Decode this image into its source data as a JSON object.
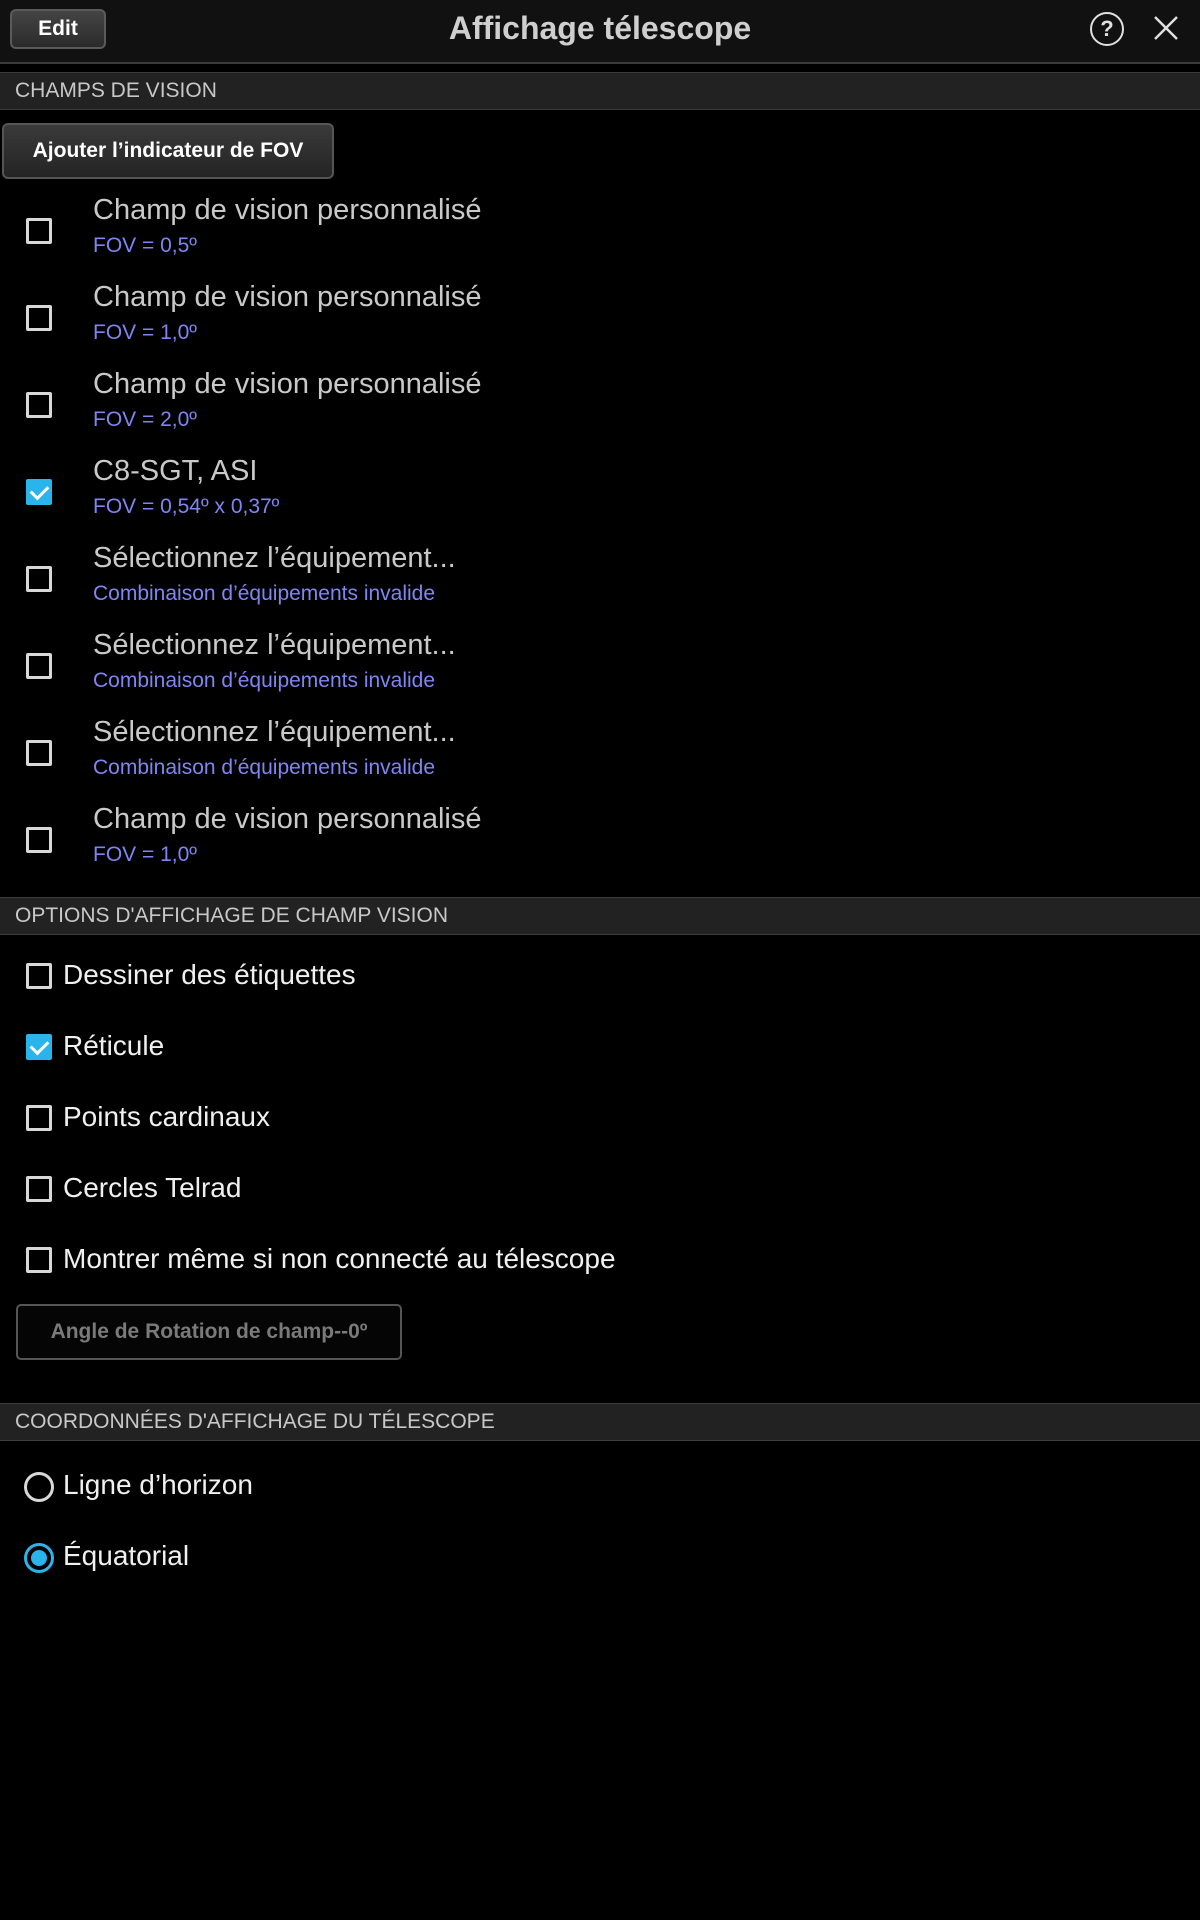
{
  "header": {
    "edit_label": "Edit",
    "title": "Affichage télescope",
    "help_glyph": "?"
  },
  "sections": {
    "fov": "CHAMPS DE VISION",
    "options": "OPTIONS D'AFFICHAGE DE CHAMP VISION",
    "coords": "COORDONNÉES D'AFFICHAGE DU TÉLESCOPE"
  },
  "add_fov_label": "Ajouter l’indicateur de FOV",
  "fov_items": [
    {
      "title": "Champ de vision personnalisé",
      "subtitle": "FOV = 0,5º",
      "checked": false
    },
    {
      "title": "Champ de vision personnalisé",
      "subtitle": "FOV = 1,0º",
      "checked": false
    },
    {
      "title": "Champ de vision personnalisé",
      "subtitle": "FOV = 2,0º",
      "checked": false
    },
    {
      "title": "C8-SGT, ASI",
      "subtitle": "FOV = 0,54º x 0,37º",
      "checked": true
    },
    {
      "title": "Sélectionnez l’équipement...",
      "subtitle": "Combinaison d’équipements invalide",
      "checked": false
    },
    {
      "title": "Sélectionnez l’équipement...",
      "subtitle": "Combinaison d’équipements invalide",
      "checked": false
    },
    {
      "title": "Sélectionnez l’équipement...",
      "subtitle": "Combinaison d’équipements invalide",
      "checked": false
    },
    {
      "title": "Champ de vision personnalisé",
      "subtitle": "FOV = 1,0º",
      "checked": false
    }
  ],
  "options": [
    {
      "label": "Dessiner des étiquettes",
      "checked": false
    },
    {
      "label": "Réticule",
      "checked": true
    },
    {
      "label": "Points cardinaux",
      "checked": false
    },
    {
      "label": "Cercles Telrad",
      "checked": false
    },
    {
      "label": "Montrer même si non connecté au télescope",
      "checked": false
    }
  ],
  "rotation_label": "Angle de Rotation de champ--0º",
  "coords": [
    {
      "label": "Ligne d’horizon",
      "selected": false
    },
    {
      "label": "Équatorial",
      "selected": true
    }
  ],
  "colors": {
    "accent": "#2ab4ec",
    "subtitle": "#7f86f2",
    "background": "#000000"
  }
}
